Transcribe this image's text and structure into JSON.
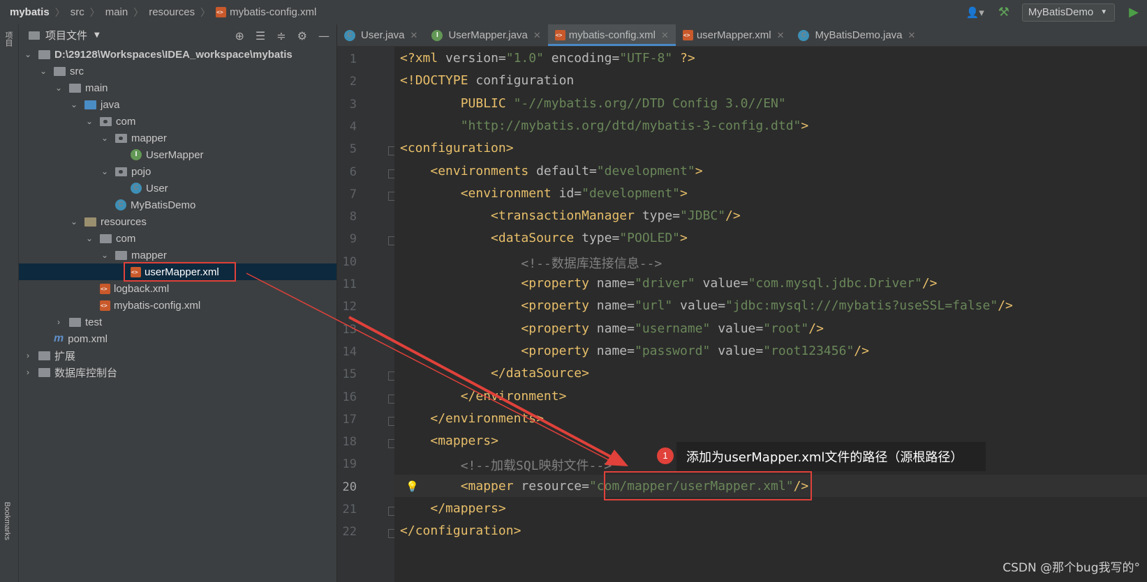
{
  "breadcrumb": [
    "mybatis",
    "src",
    "main",
    "resources",
    "mybatis-config.xml"
  ],
  "run_config": "MyBatisDemo",
  "stripe": {
    "project": "项目",
    "bookmarks": "Bookmarks"
  },
  "project_panel": {
    "title": "项目文件",
    "tree": [
      {
        "label": "D:\\29128\\Workspaces\\IDEA_workspace\\mybatis",
        "kind": "module",
        "expanded": true
      },
      {
        "label": "src",
        "kind": "folder",
        "expanded": true
      },
      {
        "label": "main",
        "kind": "folder",
        "expanded": true
      },
      {
        "label": "java",
        "kind": "source-root",
        "expanded": true
      },
      {
        "label": "com",
        "kind": "package",
        "expanded": true
      },
      {
        "label": "mapper",
        "kind": "package",
        "expanded": true
      },
      {
        "label": "UserMapper",
        "kind": "interface"
      },
      {
        "label": "pojo",
        "kind": "package",
        "expanded": true
      },
      {
        "label": "User",
        "kind": "class"
      },
      {
        "label": "MyBatisDemo",
        "kind": "class"
      },
      {
        "label": "resources",
        "kind": "resource-root",
        "expanded": true
      },
      {
        "label": "com",
        "kind": "folder",
        "expanded": true
      },
      {
        "label": "mapper",
        "kind": "folder",
        "expanded": true
      },
      {
        "label": "userMapper.xml",
        "kind": "xml",
        "selected": true
      },
      {
        "label": "logback.xml",
        "kind": "xml"
      },
      {
        "label": "mybatis-config.xml",
        "kind": "xml"
      },
      {
        "label": "test",
        "kind": "folder",
        "expanded": false
      },
      {
        "label": "pom.xml",
        "kind": "maven"
      },
      {
        "label": "扩展",
        "kind": "folder",
        "expanded": false
      },
      {
        "label": "数据库控制台",
        "kind": "folder",
        "expanded": false
      }
    ]
  },
  "tabs": [
    {
      "label": "User.java",
      "icon": "class-icon"
    },
    {
      "label": "UserMapper.java",
      "icon": "interface-icon"
    },
    {
      "label": "mybatis-config.xml",
      "icon": "xml-icon",
      "active": true
    },
    {
      "label": "userMapper.xml",
      "icon": "xml-icon"
    },
    {
      "label": "MyBatisDemo.java",
      "icon": "class-icon"
    }
  ],
  "editor": {
    "current_line": 20,
    "lines": [
      "<?xml version=\"1.0\" encoding=\"UTF-8\" ?>",
      "<!DOCTYPE configuration",
      "        PUBLIC \"-//mybatis.org//DTD Config 3.0//EN\"",
      "        \"http://mybatis.org/dtd/mybatis-3-config.dtd\">",
      "<configuration>",
      "    <environments default=\"development\">",
      "        <environment id=\"development\">",
      "            <transactionManager type=\"JDBC\"/>",
      "            <dataSource type=\"POOLED\">",
      "                <!--数据库连接信息-->",
      "                <property name=\"driver\" value=\"com.mysql.jdbc.Driver\"/>",
      "                <property name=\"url\" value=\"jdbc:mysql:///mybatis?useSSL=false\"/>",
      "                <property name=\"username\" value=\"root\"/>",
      "                <property name=\"password\" value=\"root123456\"/>",
      "            </dataSource>",
      "        </environment>",
      "    </environments>",
      "    <mappers>",
      "        <!--加载SQL映射文件-->",
      "        <mapper resource=\"com/mapper/userMapper.xml\"/>",
      "    </mappers>",
      "</configuration>"
    ]
  },
  "annotation": {
    "number": "1",
    "text": "添加为userMapper.xml文件的路径（源根路径）"
  },
  "watermark": "CSDN @那个bug我写的°",
  "colors": {
    "accent": "#4a88c7",
    "annotation_red": "#e0413a",
    "tag": "#e8bf6a",
    "string": "#6a8759",
    "comment": "#808080"
  }
}
